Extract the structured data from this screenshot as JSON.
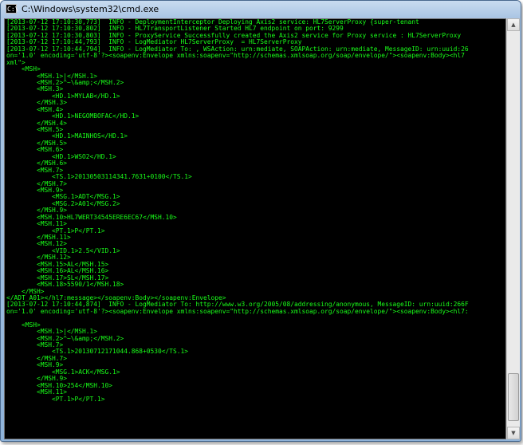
{
  "window": {
    "title": "C:\\Windows\\system32\\cmd.exe",
    "icon": "cmd-icon"
  },
  "console": {
    "text_color": "#19ff19",
    "background_color": "#000000",
    "lines": [
      "[2013-07-12 17:10:30,773]  INFO - DeploymentInterceptor Deploying Axis2 service: HL7ServerProxy {super-tenant",
      "[2013-07-12 17:10:30,802]  INFO - HL7TransportListener Started HL7 endpoint on port: 9299",
      "[2013-07-12 17:10:30,803]  INFO - ProxyService Successfully created the Axis2 service for Proxy service : HL7ServerProxy",
      "[2013-07-12 17:10:44,793]  INFO - LogMediator HL7ServerProxy  = HL7ServerProxy",
      "[2013-07-12 17:10:44,794]  INFO - LogMediator To: , WSAction: urn:mediate, SOAPAction: urn:mediate, MessageID: urn:uuid:26",
      "on='1.0' encoding='utf-8'?><soapenv:Envelope xmlns:soapenv=\"http://schemas.xmlsoap.org/soap/envelope/\"><soapenv:Body><hl7",
      "xml\">",
      "    <MSH>",
      "        <MSH.1>|</MSH.1>",
      "        <MSH.2>^~\\&amp;</MSH.2>",
      "        <MSH.3>",
      "            <HD.1>MYLAB</HD.1>",
      "        </MSH.3>",
      "        <MSH.4>",
      "            <HD.1>NEGOMBOFAC</HD.1>",
      "        </MSH.4>",
      "        <MSH.5>",
      "            <HD.1>MAINHOS</HD.1>",
      "        </MSH.5>",
      "        <MSH.6>",
      "            <HD.1>WSO2</HD.1>",
      "        </MSH.6>",
      "        <MSH.7>",
      "            <TS.1>20130503114341.7631+0100</TS.1>",
      "        </MSH.7>",
      "        <MSH.9>",
      "            <MSG.1>ADT</MSG.1>",
      "            <MSG.2>A01</MSG.2>",
      "        </MSH.9>",
      "        <MSH.10>HL7WERT34545ERE6EC67</MSH.10>",
      "        <MSH.11>",
      "            <PT.1>P</PT.1>",
      "        </MSH.11>",
      "        <MSH.12>",
      "            <VID.1>2.5</VID.1>",
      "        </MSH.12>",
      "        <MSH.15>AL</MSH.15>",
      "        <MSH.16>AL</MSH.16>",
      "        <MSH.17>SL</MSH.17>",
      "        <MSH.18>5590/1</MSH.18>",
      "    </MSH>",
      "</ADT_A01></hl7:message></soapenv:Body></soapenv:Envelope>",
      "[2013-07-12 17:10:44,874]  INFO - LogMediator To: http://www.w3.org/2005/08/addressing/anonymous, MessageID: urn:uuid:266F",
      "on='1.0' encoding='utf-8'?><soapenv:Envelope xmlns:soapenv=\"http://schemas.xmlsoap.org/soap/envelope/\"><soapenv:Body><hl7:",
      "",
      "    <MSH>",
      "        <MSH.1>|</MSH.1>",
      "        <MSH.2>^~\\&amp;</MSH.2>",
      "        <MSH.7>",
      "            <TS.1>20130712171044.868+0530</TS.1>",
      "        </MSH.7>",
      "        <MSH.9>",
      "            <MSG.1>ACK</MSG.1>",
      "        </MSH.9>",
      "        <MSH.10>254</MSH.10>",
      "        <MSH.11>",
      "            <PT.1>P</PT.1>"
    ]
  },
  "scrollbar": {
    "position_fraction": 0.985,
    "visible_fraction": 0.12
  }
}
